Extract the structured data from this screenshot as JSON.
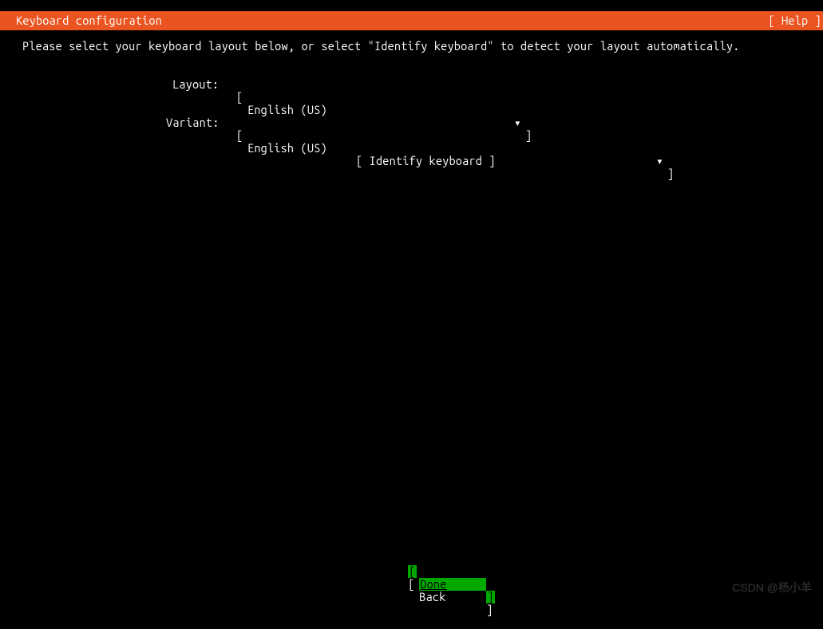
{
  "colors": {
    "bg": "#000000",
    "accent": "#e95420",
    "active_btn_bg": "#00a800",
    "text": "#ffffff"
  },
  "header": {
    "title": "Keyboard configuration",
    "help": "[ Help ]"
  },
  "instruction": "Please select your keyboard layout below, or select \"Identify keyboard\" to detect your layout automatically.",
  "layout": {
    "label": "Layout:",
    "open": "[",
    "value": "English (US)",
    "arrow": "▾",
    "close": "]"
  },
  "variant": {
    "label": "Variant:",
    "open": "[",
    "value": "English (US)",
    "arrow": "▾",
    "close": "]"
  },
  "identify": {
    "label": "[ Identify keyboard ]"
  },
  "footer": {
    "done": {
      "text": "Done",
      "lb": "[",
      "rb": "]"
    },
    "back": {
      "text": "Back",
      "lb": "[",
      "rb": "]"
    }
  },
  "watermark": "CSDN @杨小羊"
}
